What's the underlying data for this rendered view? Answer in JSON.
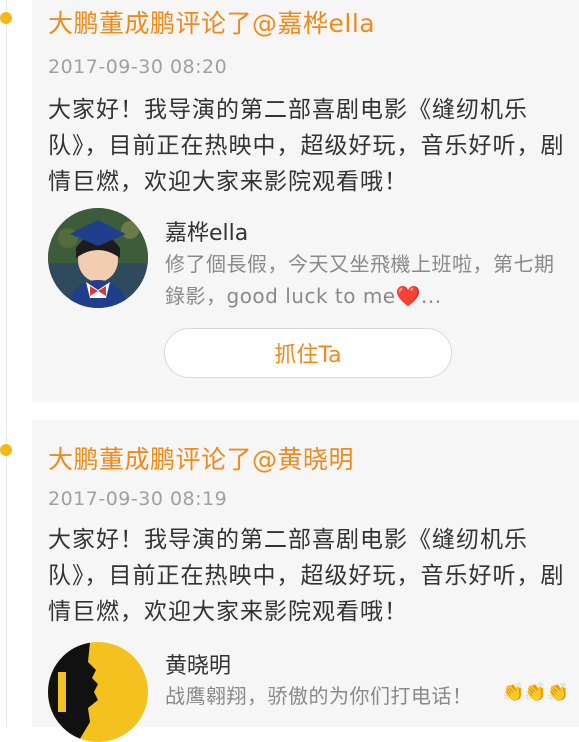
{
  "comments": [
    {
      "title": "大鹏董成鹏评论了@嘉桦ella",
      "time": "2017-09-30 08:20",
      "body": "大家好！我导演的第二部喜剧电影《缝纫机乐队》，目前正在热映中，超级好玩，音乐好听，剧情巨燃，欢迎大家来影院观看哦！",
      "user": {
        "name": "嘉桦ella",
        "post_line1": "修了個長假，今天又坐飛機上班啦，第七期",
        "post_line2": "錄影，good luck to me",
        "post_suffix": "...",
        "heart": "❤️"
      },
      "button_label": "抓住Ta"
    },
    {
      "title": "大鹏董成鹏评论了@黄晓明",
      "time": "2017-09-30 08:19",
      "body": "大家好！我导演的第二部喜剧电影《缝纫机乐队》，目前正在热映中，超级好玩，音乐好听，剧情巨燃，欢迎大家来影院观看哦！",
      "user": {
        "name": "黄晓明",
        "post_line1": "战鹰翱翔，骄傲的为你们打电话！",
        "claps": "👏👏👏"
      }
    }
  ],
  "colors": {
    "accent": "#f08a1a",
    "dot": "#f5b81c",
    "card_bg": "#f6f6f6"
  },
  "icons": {
    "timeline_dot": "timeline-dot-icon",
    "heart": "heart-icon",
    "claps": "clap-icon"
  }
}
